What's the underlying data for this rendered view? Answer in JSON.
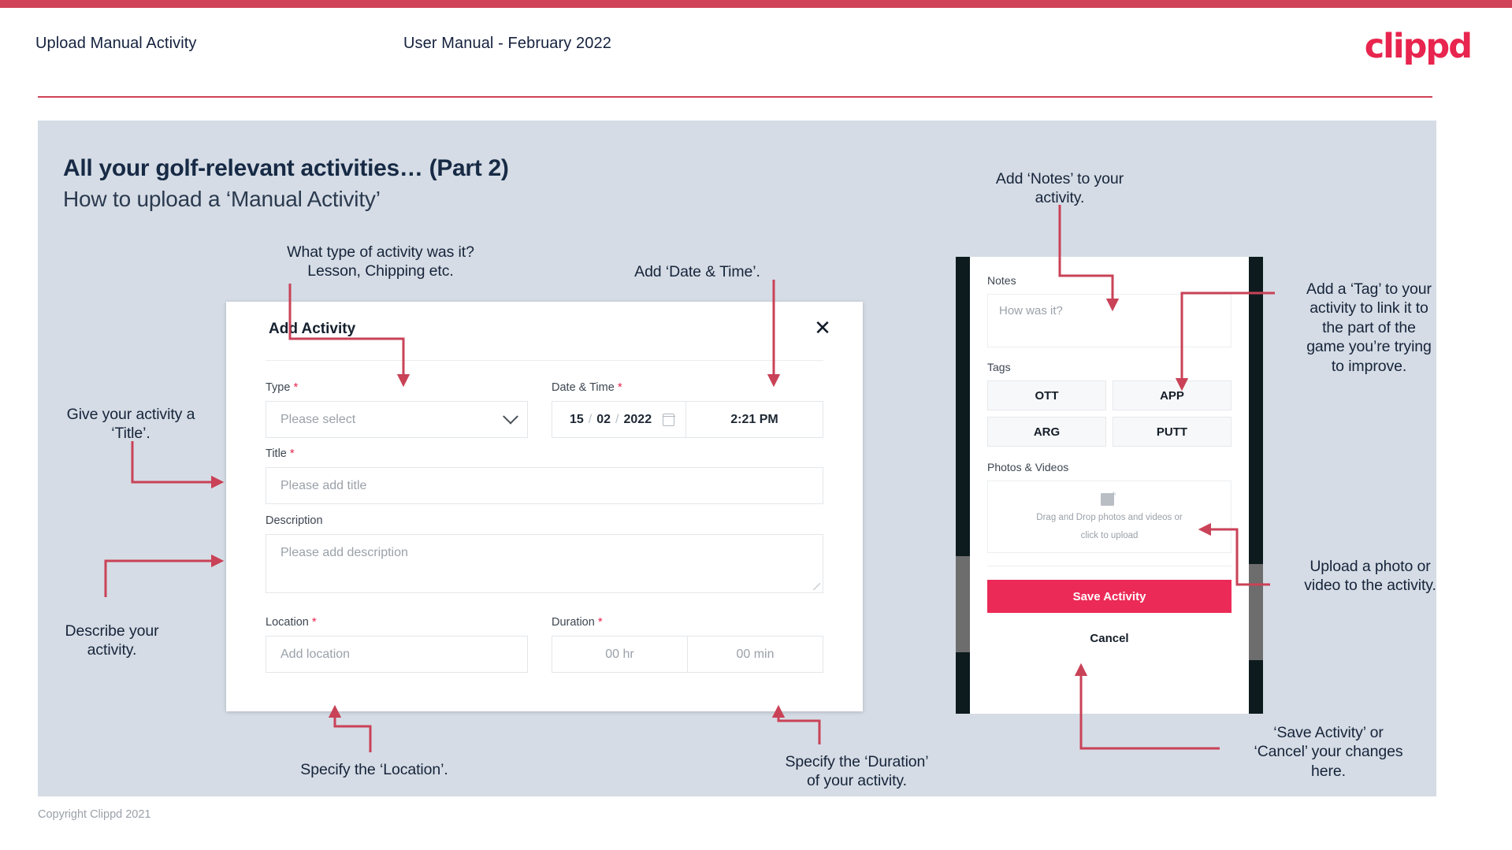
{
  "header": {
    "title": "Upload Manual Activity",
    "subtitle": "User Manual - February 2022",
    "logo": "clippd"
  },
  "slide": {
    "title": "All your golf-relevant activities… (Part 2)",
    "subtitle": "How to upload a ‘Manual Activity’"
  },
  "dialog": {
    "title": "Add Activity",
    "close_icon": "close-icon",
    "fields": {
      "type": {
        "label": "Type",
        "required": "*",
        "placeholder": "Please select"
      },
      "datetime": {
        "label": "Date & Time",
        "required": "*",
        "day": "15",
        "month": "02",
        "year": "2022",
        "sep": "/",
        "time": "2:21 PM"
      },
      "title": {
        "label": "Title",
        "required": "*",
        "placeholder": "Please add title"
      },
      "description": {
        "label": "Description",
        "placeholder": "Please add description"
      },
      "location": {
        "label": "Location",
        "required": "*",
        "placeholder": "Add location"
      },
      "duration": {
        "label": "Duration",
        "required": "*",
        "hours": "00 hr",
        "minutes": "00 min"
      }
    }
  },
  "phone": {
    "notes_label": "Notes",
    "notes_placeholder": "How was it?",
    "tags_label": "Tags",
    "tags": [
      "OTT",
      "APP",
      "ARG",
      "PUTT"
    ],
    "photos_label": "Photos & Videos",
    "dropzone_line1": "Drag and Drop photos and videos or",
    "dropzone_line2": "click to upload",
    "save_label": "Save Activity",
    "cancel_label": "Cancel"
  },
  "annotations": {
    "type": "What type of activity was it?\nLesson, Chipping etc.",
    "datetime": "Add ‘Date & Time’.",
    "notes": "Add ‘Notes’ to your\nactivity.",
    "tag": "Add a ‘Tag’ to your\nactivity to link it to\nthe part of the\ngame you’re trying\nto improve.",
    "title": "Give your activity a\n‘Title’.",
    "description": "Describe your\nactivity.",
    "location": "Specify the ‘Location’.",
    "duration": "Specify the ‘Duration’\nof your activity.",
    "upload": "Upload a photo or\nvideo to the activity.",
    "save": "‘Save Activity’ or\n‘Cancel’ your changes\nhere."
  },
  "footer": {
    "copyright": "Copyright Clippd 2021"
  },
  "colors": {
    "accent": "#e8254e",
    "top_bar": "#cf4257",
    "panel_bg": "#d5dce5",
    "arrow": "#c94257",
    "text_dark": "#16243a",
    "save_button": "#ec2a57"
  }
}
